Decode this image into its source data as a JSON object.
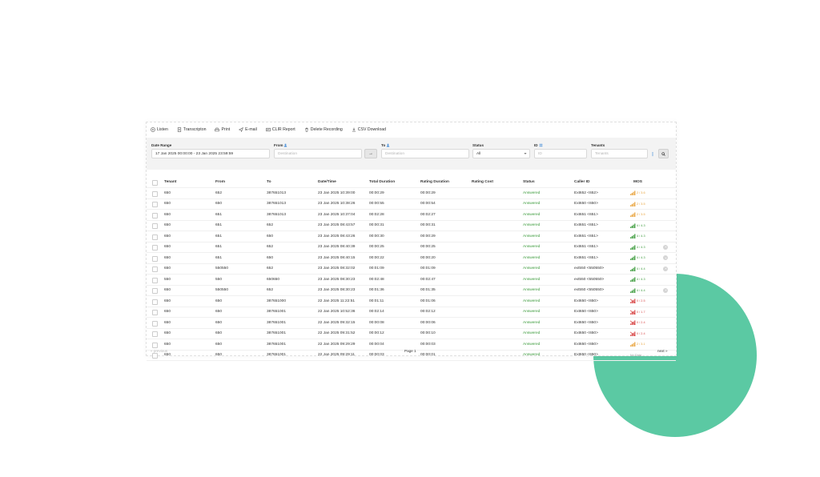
{
  "toolbar": {
    "listen": "Listen",
    "transcription": "Transcripton",
    "print": "Print",
    "email": "E-mail",
    "clir": "CLIR Report",
    "delete": "Delete Recording",
    "csv": "CSV Download"
  },
  "filters": {
    "date_range_label": "Date Range",
    "date_range_value": "17 Jan 2025 00:00:00 - 23 Jan 2025 23:59:59",
    "from_label": "From",
    "from_placeholder": "Destination",
    "to_label": "To",
    "to_placeholder": "Destination",
    "status_label": "Status",
    "status_value": "All",
    "id_label": "ID",
    "id_placeholder": "ID",
    "tenants_label": "Tenants",
    "tenants_placeholder": "Tenants"
  },
  "table": {
    "columns": [
      "Tenant",
      "From",
      "To",
      "Date/Time",
      "Total Duration",
      "Rating Duration",
      "Rating Cost",
      "Status",
      "Caller ID",
      "MOS"
    ],
    "rows": [
      {
        "tenant": "650",
        "from": "652",
        "to": "387651013",
        "datetime": "23 Jan 2025 10:39:00",
        "total": "00:00:29",
        "rating": "00:00:29",
        "cost": "",
        "status": "Answered",
        "caller": "Ext652 <652>",
        "mos": "2 / 3.6",
        "mos_level": "mid",
        "action": false
      },
      {
        "tenant": "650",
        "from": "650",
        "to": "387651013",
        "datetime": "23 Jan 2025 10:38:26",
        "total": "00:00:55",
        "rating": "00:00:54",
        "cost": "",
        "status": "Answered",
        "caller": "Ext650 <650>",
        "mos": "2 / 3.5",
        "mos_level": "mid",
        "action": false
      },
      {
        "tenant": "650",
        "from": "651",
        "to": "387651013",
        "datetime": "23 Jan 2025 10:37:04",
        "total": "00:02:28",
        "rating": "00:02:27",
        "cost": "",
        "status": "Answered",
        "caller": "Ext651 <651>",
        "mos": "2 / 3.5",
        "mos_level": "mid",
        "action": false
      },
      {
        "tenant": "650",
        "from": "651",
        "to": "652",
        "datetime": "23 Jan 2025 08:43:57",
        "total": "00:00:31",
        "rating": "00:00:31",
        "cost": "",
        "status": "Answered",
        "caller": "Ext651 <651>",
        "mos": "4 / 4.3",
        "mos_level": "good",
        "action": false
      },
      {
        "tenant": "650",
        "from": "651",
        "to": "650",
        "datetime": "23 Jan 2025 08:43:26",
        "total": "00:00:30",
        "rating": "00:00:29",
        "cost": "",
        "status": "Answered",
        "caller": "Ext651 <651>",
        "mos": "4 / 4.3",
        "mos_level": "good",
        "action": false
      },
      {
        "tenant": "650",
        "from": "651",
        "to": "652",
        "datetime": "23 Jan 2025 08:40:39",
        "total": "00:00:25",
        "rating": "00:00:25",
        "cost": "",
        "status": "Answered",
        "caller": "Ext651 <651>",
        "mos": "4 / 4.3",
        "mos_level": "good",
        "action": true
      },
      {
        "tenant": "650",
        "from": "651",
        "to": "650",
        "datetime": "23 Jan 2025 08:40:15",
        "total": "00:00:22",
        "rating": "00:00:20",
        "cost": "",
        "status": "Answered",
        "caller": "Ext651 <651>",
        "mos": "4 / 4.3",
        "mos_level": "good",
        "action": true
      },
      {
        "tenant": "650",
        "from": "550550",
        "to": "652",
        "datetime": "23 Jan 2025 08:32:02",
        "total": "00:01:09",
        "rating": "00:01:09",
        "cost": "",
        "status": "Answered",
        "caller": "ext550 <550550>",
        "mos": "4 / 4.4",
        "mos_level": "good",
        "action": true
      },
      {
        "tenant": "550",
        "from": "550",
        "to": "650650",
        "datetime": "23 Jan 2025 08:30:23",
        "total": "00:02:48",
        "rating": "00:02:47",
        "cost": "",
        "status": "Answered",
        "caller": "ext550 <550550>",
        "mos": "4 / 4.3",
        "mos_level": "good",
        "action": false
      },
      {
        "tenant": "650",
        "from": "550550",
        "to": "652",
        "datetime": "23 Jan 2025 08:30:23",
        "total": "00:01:36",
        "rating": "00:01:35",
        "cost": "",
        "status": "Answered",
        "caller": "ext550 <550550>",
        "mos": "4 / 4.4",
        "mos_level": "good",
        "action": true
      },
      {
        "tenant": "650",
        "from": "650",
        "to": "387651000",
        "datetime": "22 Jan 2025 11:22:51",
        "total": "00:01:11",
        "rating": "00:01:06",
        "cost": "",
        "status": "Answered",
        "caller": "Ext650 <650>",
        "mos": "0 / 2.5",
        "mos_level": "bad",
        "action": false
      },
      {
        "tenant": "650",
        "from": "650",
        "to": "387651001",
        "datetime": "22 Jan 2025 10:52:36",
        "total": "00:02:14",
        "rating": "00:02:12",
        "cost": "",
        "status": "Answered",
        "caller": "Ext650 <650>",
        "mos": "0 / 1.7",
        "mos_level": "bad",
        "action": false
      },
      {
        "tenant": "650",
        "from": "650",
        "to": "387651001",
        "datetime": "22 Jan 2025 09:32:15",
        "total": "00:00:08",
        "rating": "00:00:06",
        "cost": "",
        "status": "Answered",
        "caller": "Ext650 <650>",
        "mos": "0 / 2.4",
        "mos_level": "bad",
        "action": false
      },
      {
        "tenant": "650",
        "from": "650",
        "to": "387651001",
        "datetime": "22 Jan 2025 09:31:52",
        "total": "00:00:12",
        "rating": "00:00:10",
        "cost": "",
        "status": "Answered",
        "caller": "Ext650 <650>",
        "mos": "0 / 2.4",
        "mos_level": "bad",
        "action": false
      },
      {
        "tenant": "650",
        "from": "650",
        "to": "387651001",
        "datetime": "22 Jan 2025 09:29:29",
        "total": "00:00:04",
        "rating": "00:00:03",
        "cost": "",
        "status": "Answered",
        "caller": "Ext650 <650>",
        "mos": "2 / 3.1",
        "mos_level": "mid",
        "action": false
      },
      {
        "tenant": "650",
        "from": "650",
        "to": "387651001",
        "datetime": "22 Jan 2025 09:29:11",
        "total": "00:00:03",
        "rating": "00:00:01",
        "cost": "",
        "status": "Answered",
        "caller": "Ext650 <650>",
        "mos": "No Data",
        "mos_level": "none",
        "action": false
      }
    ]
  },
  "pagination": {
    "previous": "« previous",
    "page": "Page 1",
    "next": "next »"
  },
  "colors": {
    "accent": "#3a9a3a",
    "decor": "#5bc9a3",
    "bad": "#d94a4a",
    "mid": "#e8a23a"
  }
}
